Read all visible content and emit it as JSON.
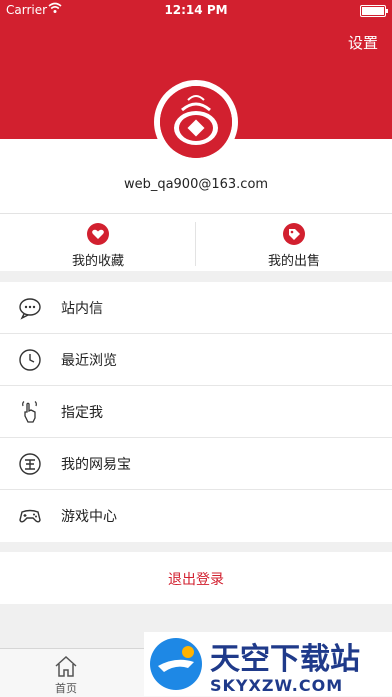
{
  "status_bar": {
    "carrier": "Carrier",
    "time": "12:14 PM"
  },
  "header": {
    "settings_label": "设置"
  },
  "profile": {
    "email": "web_qa900@163.com"
  },
  "tiles": [
    {
      "label": "我的收藏",
      "icon": "heart-icon"
    },
    {
      "label": "我的出售",
      "icon": "tag-icon"
    }
  ],
  "menu": [
    {
      "label": "站内信",
      "icon": "chat-icon"
    },
    {
      "label": "最近浏览",
      "icon": "clock-icon"
    },
    {
      "label": "指定我",
      "icon": "hand-pointer-icon"
    },
    {
      "label": "我的网易宝",
      "icon": "wallet-coin-icon"
    },
    {
      "label": "游戏中心",
      "icon": "gamepad-icon"
    }
  ],
  "logout_label": "退出登录",
  "tabbar": {
    "home_label": "首页"
  },
  "watermark": {
    "title": "天空下载站",
    "subtitle": "SKYXZW.COM"
  },
  "colors": {
    "brand": "#d2202f"
  }
}
